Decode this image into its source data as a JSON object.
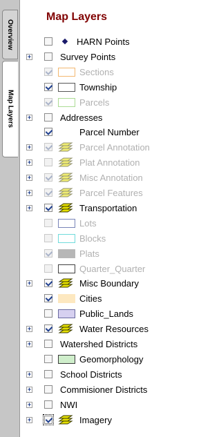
{
  "tabs": {
    "overview": "Overview",
    "layers": "Map Layers"
  },
  "panel": {
    "title": "Map Layers"
  },
  "colors": {
    "title": "#800000",
    "layer_icon_fill": "#e5e000",
    "expander": "#1a3a8a"
  },
  "layers": [
    {
      "label": "HARN Points",
      "expander": false,
      "checked": false,
      "dim": false,
      "symbol": "diamond-point"
    },
    {
      "label": "Survey Points",
      "expander": true,
      "checked": false,
      "dim": false,
      "symbol": "none"
    },
    {
      "label": "Sections",
      "expander": false,
      "checked": true,
      "dim": true,
      "symbol": "box",
      "symbol_border": "#f0a040",
      "symbol_fill": "#ffffff"
    },
    {
      "label": "Township",
      "expander": false,
      "checked": true,
      "dim": false,
      "symbol": "box",
      "symbol_border": "#555555",
      "symbol_fill": "#ffffff"
    },
    {
      "label": "Parcels",
      "expander": false,
      "checked": true,
      "dim": true,
      "symbol": "box",
      "symbol_border": "#90d070",
      "symbol_fill": "#ffffff"
    },
    {
      "label": "Addresses",
      "expander": true,
      "checked": false,
      "dim": false,
      "symbol": "none"
    },
    {
      "label": "Parcel Number",
      "expander": false,
      "checked": true,
      "dim": false,
      "symbol": "none-indented"
    },
    {
      "label": "Parcel Annotation",
      "expander": true,
      "checked": true,
      "dim": true,
      "symbol": "layers-icon"
    },
    {
      "label": "Plat Annotation",
      "expander": true,
      "checked": false,
      "dim": true,
      "symbol": "layers-icon"
    },
    {
      "label": "Misc Annotation",
      "expander": true,
      "checked": true,
      "dim": true,
      "symbol": "layers-icon"
    },
    {
      "label": "Parcel Features",
      "expander": true,
      "checked": true,
      "dim": true,
      "symbol": "layers-icon"
    },
    {
      "label": "Transportation",
      "expander": true,
      "checked": true,
      "dim": false,
      "symbol": "layers-icon"
    },
    {
      "label": "Lots",
      "expander": false,
      "checked": false,
      "dim": true,
      "symbol": "box",
      "symbol_border": "#4a5aa0",
      "symbol_fill": "#ffffff"
    },
    {
      "label": "Blocks",
      "expander": false,
      "checked": false,
      "dim": true,
      "symbol": "box",
      "symbol_border": "#40d0d0",
      "symbol_fill": "#ffffff"
    },
    {
      "label": "Plats",
      "expander": false,
      "checked": true,
      "dim": true,
      "symbol": "box",
      "symbol_border": "#a0a0a0",
      "symbol_fill": "#a0a0a0"
    },
    {
      "label": "Quarter_Quarter",
      "expander": false,
      "checked": false,
      "dim": true,
      "symbol": "box",
      "symbol_border": "#000000",
      "symbol_fill": "#ffffff"
    },
    {
      "label": "Misc Boundary",
      "expander": true,
      "checked": true,
      "dim": false,
      "symbol": "layers-icon"
    },
    {
      "label": "Cities",
      "expander": false,
      "checked": true,
      "dim": false,
      "symbol": "box",
      "symbol_border": "#fde8c0",
      "symbol_fill": "#fde8c0"
    },
    {
      "label": "Public_Lands",
      "expander": false,
      "checked": false,
      "dim": false,
      "symbol": "box",
      "symbol_border": "#6a6aa0",
      "symbol_fill": "#d6d0f0"
    },
    {
      "label": "Water Resources",
      "expander": true,
      "checked": true,
      "dim": false,
      "symbol": "layers-icon"
    },
    {
      "label": "Watershed Districts",
      "expander": true,
      "checked": false,
      "dim": false,
      "symbol": "none"
    },
    {
      "label": "Geomorphology",
      "expander": false,
      "checked": false,
      "dim": false,
      "symbol": "box",
      "symbol_border": "#3a3a3a",
      "symbol_fill": "#cfeecb"
    },
    {
      "label": "School Districts",
      "expander": true,
      "checked": false,
      "dim": false,
      "symbol": "none"
    },
    {
      "label": "Commisioner Districts",
      "expander": true,
      "checked": false,
      "dim": false,
      "symbol": "none"
    },
    {
      "label": "NWI",
      "expander": true,
      "checked": false,
      "dim": false,
      "symbol": "none"
    },
    {
      "label": "Imagery",
      "expander": true,
      "checked": true,
      "dim": false,
      "symbol": "layers-icon",
      "focused": true
    }
  ]
}
